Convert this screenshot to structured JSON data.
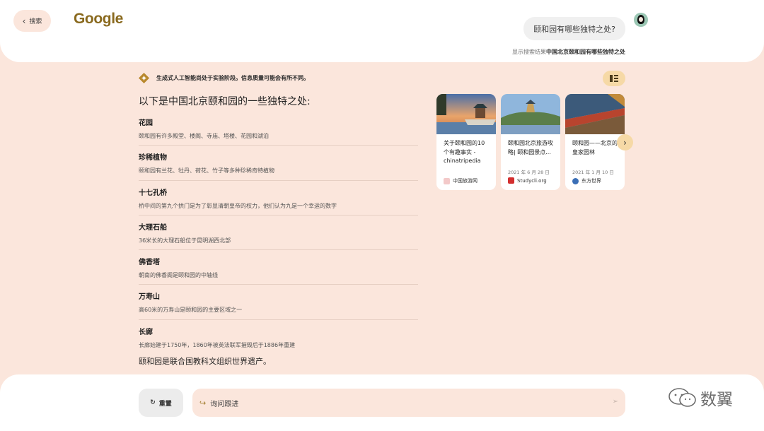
{
  "header": {
    "back_label": "搜索",
    "logo": "Google",
    "query": "颐和园有哪些独特之处?",
    "results_prefix": "显示搜索结果",
    "results_query": "中国北京颐和园有哪些独特之处"
  },
  "disclaimer": "生成式人工智能尚处于实验阶段。信息质量可能会有所不同。",
  "answer": {
    "title": "以下是中国北京颐和园的一些独特之处:",
    "items": [
      {
        "title": "花园",
        "desc": "颐和园有许多殿堂、楼阁、寺庙、塔楼、花园和湖泊"
      },
      {
        "title": "珍稀植物",
        "desc": "颐和园有兰花、牡丹、荷花、竹子等多种珍稀奇特植物"
      },
      {
        "title": "十七孔桥",
        "desc": "桥中间的第九个拱门是为了彰显清朝皇帝的权力，他们认为九是一个幸运的数字"
      },
      {
        "title": "大理石船",
        "desc": "36米长的大理石船位于昆明湖西北部"
      },
      {
        "title": "佛香塔",
        "desc": "朝南的佛香阁是颐和园的中轴线"
      },
      {
        "title": "万寿山",
        "desc": "高60米的万寿山是颐和园的主要区域之一"
      },
      {
        "title": "长廊",
        "desc": "长廊始建于1750年，1860年被英法联军摧毁后于1886年重建"
      }
    ],
    "conclusion": "颐和园是联合国教科文组织世界遗产。"
  },
  "cards": [
    {
      "title": "关于颐和园的10个有趣事实 - chinatripedia",
      "date": "",
      "source": "中国旅游网",
      "icon_color": "#e8a6a6"
    },
    {
      "title": "颐和园北京旅游攻略| 颐和园景点...",
      "date": "2021 年 6 月 28 日",
      "source": "Studycli.org",
      "icon_color": "#d32f2f"
    },
    {
      "title": "颐和园——北京的皇家园林",
      "date": "2021 年 1 月 10 日",
      "source": "东方世界",
      "icon_color": "#3b6fb6"
    }
  ],
  "footer": {
    "reset_label": "重置",
    "followup_placeholder": "询问跟进",
    "watermark": "数翼"
  },
  "colors": {
    "page_bg": "#fbe6dc",
    "accent": "#f6d9a6",
    "logo": "#8a6a1f"
  }
}
